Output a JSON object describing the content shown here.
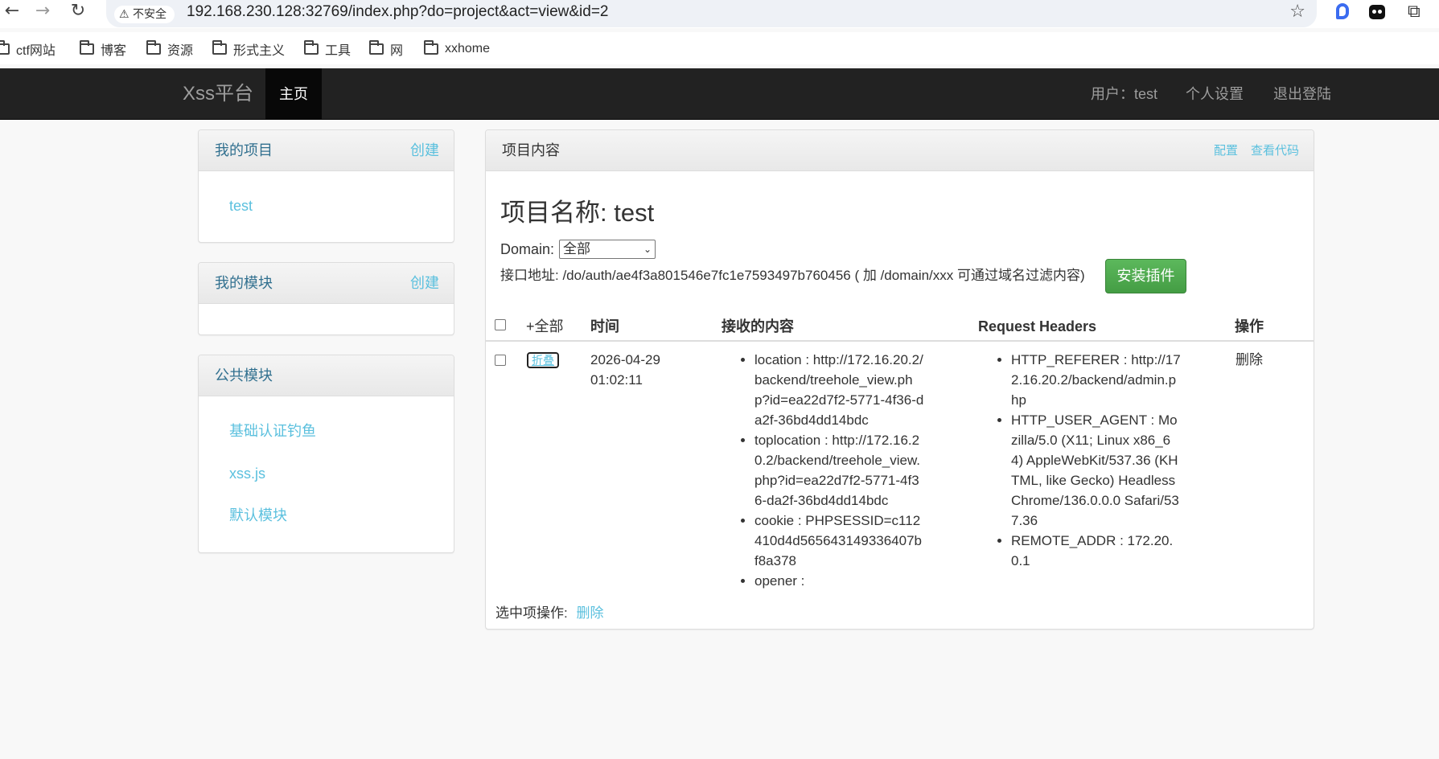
{
  "browser": {
    "security_label": "不安全",
    "url": "192.168.230.128:32769/index.php?do=project&act=view&id=2",
    "bookmarks": [
      "ctf网站",
      "博客",
      "资源",
      "形式主义",
      "工具",
      "网",
      "xxhome"
    ]
  },
  "navbar": {
    "brand": "Xss平台",
    "home": "主页",
    "user": "用户：test",
    "settings": "个人设置",
    "logout": "退出登陆"
  },
  "sidebar": {
    "my_projects": {
      "title": "我的项目",
      "action": "创建",
      "items": [
        "test"
      ]
    },
    "my_modules": {
      "title": "我的模块",
      "action": "创建"
    },
    "public_modules": {
      "title": "公共模块",
      "items": [
        "基础认证钓鱼",
        "xss.js",
        "默认模块"
      ]
    }
  },
  "main": {
    "panel_title": "项目内容",
    "config_link": "配置",
    "view_code_link": "查看代码",
    "project_title": "项目名称: test",
    "domain_label": "Domain:",
    "domain_value": "全部",
    "api_text": "接口地址: /do/auth/ae4f3a801546e7fc1e7593497b760456 ( 加 /domain/xxx 可通过域名过滤内容)",
    "install_button": "安装插件",
    "table": {
      "headers": {
        "all": "+全部",
        "time": "时间",
        "content": "接收的内容",
        "request_headers": "Request Headers",
        "ops": "操作"
      },
      "rows": [
        {
          "fold": "折叠",
          "date": "2026-04-29",
          "time": "01:02:11",
          "content": [
            "location : http://172.16.20.2/backend/treehole_view.php?id=ea22d7f2-5771-4f36-da2f-36bd4dd14bdc",
            "toplocation : http://172.16.20.2/backend/treehole_view.php?id=ea22d7f2-5771-4f36-da2f-36bd4dd14bdc",
            "cookie : PHPSESSID=c112410d4d565643149336407bf8a378",
            "opener :"
          ],
          "headers": [
            "HTTP_REFERER : http://172.16.20.2/backend/admin.php",
            "HTTP_USER_AGENT : Mozilla/5.0 (X11; Linux x86_64) AppleWebKit/537.36 (KHTML, like Gecko) HeadlessChrome/136.0.0.0 Safari/537.36",
            "REMOTE_ADDR : 172.20.0.1"
          ],
          "delete": "删除"
        }
      ]
    },
    "bulk_label": "选中项操作:",
    "bulk_delete": "删除"
  }
}
